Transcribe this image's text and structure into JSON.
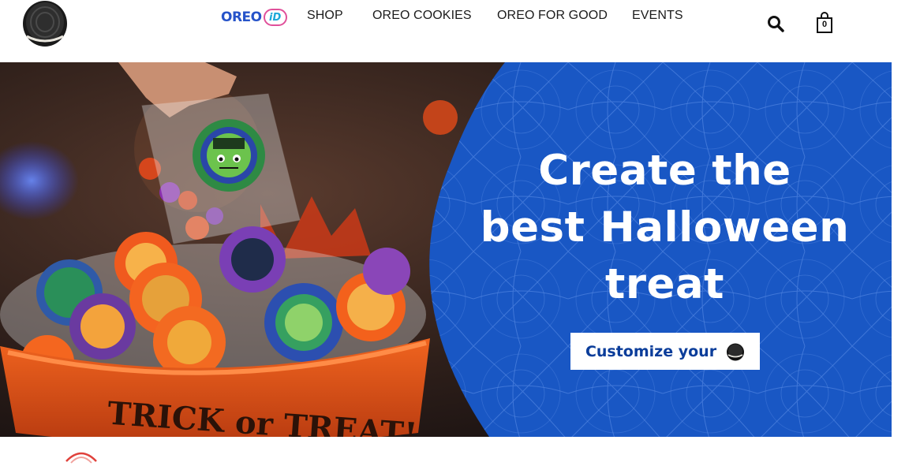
{
  "header": {
    "logo": {
      "icon": "oreo-cookie-logo-icon"
    },
    "oreoid": {
      "part1": "OREO",
      "part2": "iD"
    },
    "nav": [
      {
        "label": "SHOP"
      },
      {
        "label": "OREO COOKIES"
      },
      {
        "label": "OREO FOR GOOD"
      },
      {
        "label": "EVENTS"
      }
    ],
    "search_icon": "search-icon",
    "cart": {
      "icon": "shopping-bag-icon",
      "count": "0"
    }
  },
  "hero": {
    "headline": [
      "Create the",
      "best Halloween",
      "treat"
    ],
    "cta_label": "Customize your",
    "cta_icon": "oreo-cookie-icon",
    "colors": {
      "panel_blue": "#1957c4",
      "cta_text": "#0b3d9a",
      "bowl_orange": "#e2501c"
    }
  }
}
